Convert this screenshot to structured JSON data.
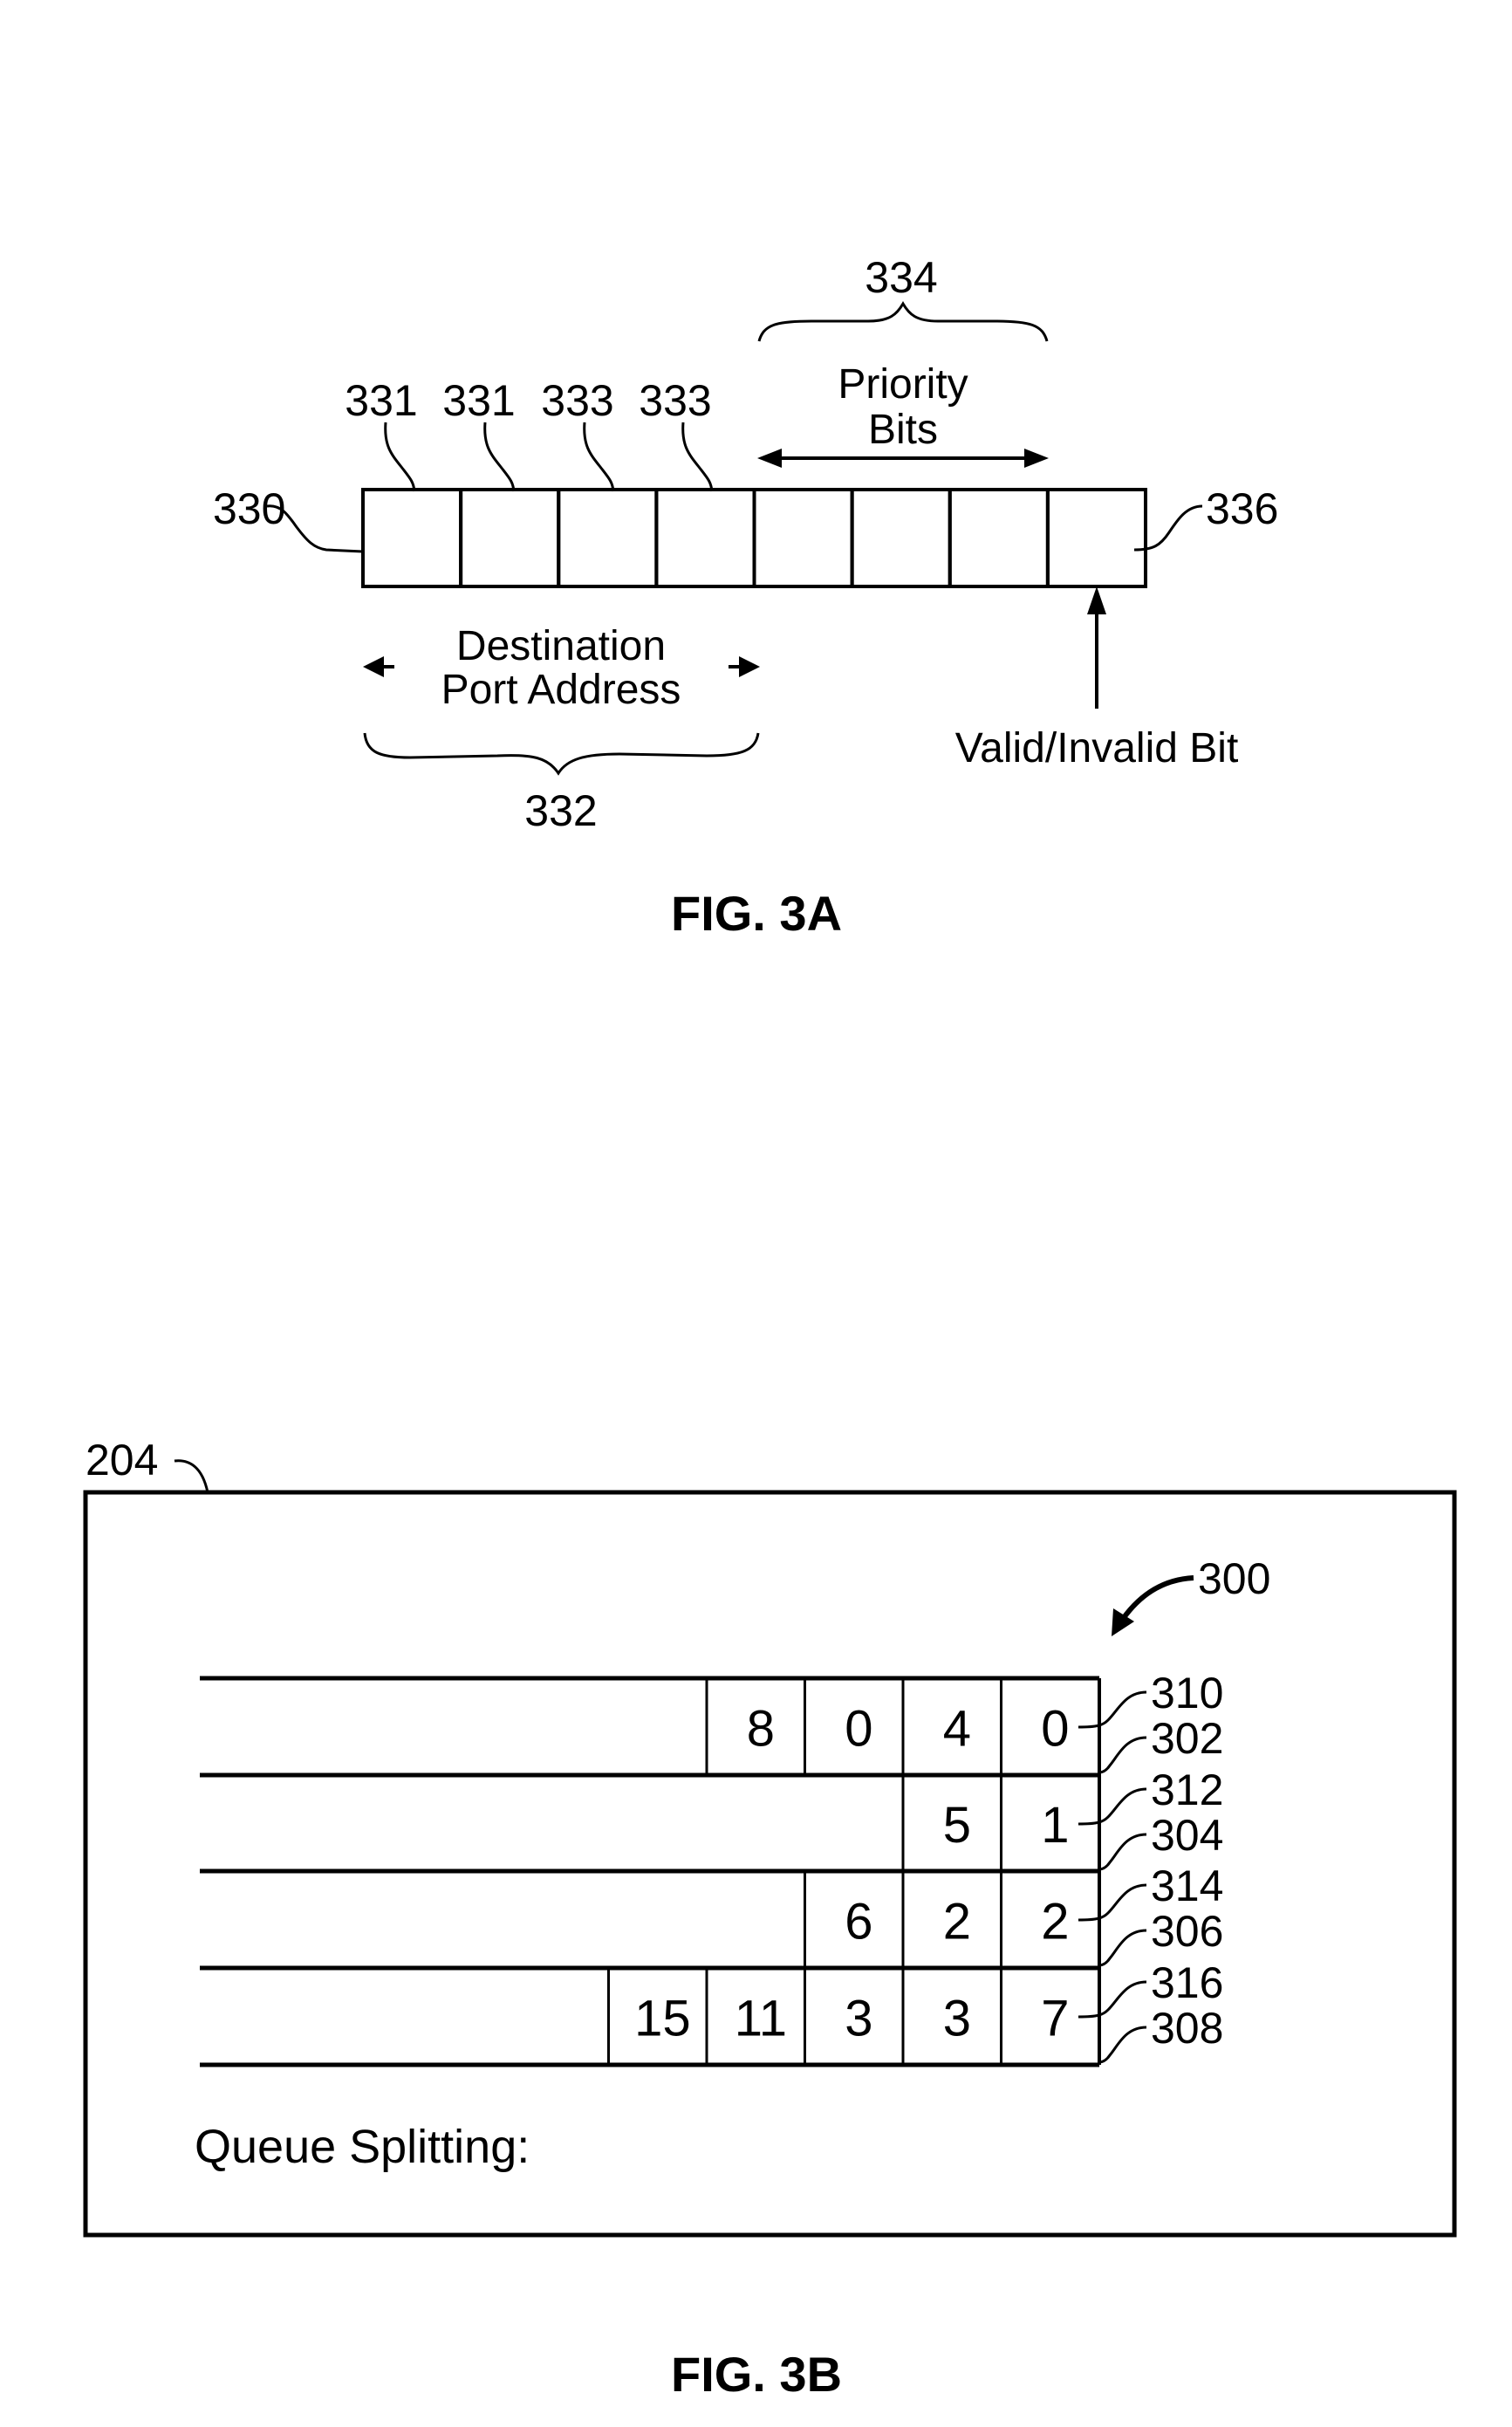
{
  "fig3a": {
    "caption": "FIG. 3A",
    "register_ref": "330",
    "cell_count": 8,
    "cell_refs": [
      "331",
      "331",
      "333",
      "333"
    ],
    "priority_group_ref": "334",
    "priority_label_line1": "Priority",
    "priority_label_line2": "Bits",
    "valid_cell_ref": "336",
    "destination_label_line1": "Destination",
    "destination_label_line2": "Port Address",
    "destination_group_ref": "332",
    "valid_label": "Valid/Invalid Bit"
  },
  "fig3b": {
    "caption": "FIG. 3B",
    "container_ref": "204",
    "structure_ref": "300",
    "footer_label": "Queue Splitting:",
    "queues": [
      {
        "head_ref": "310",
        "queue_ref": "302",
        "values": [
          "8",
          "0",
          "4",
          "0"
        ]
      },
      {
        "head_ref": "312",
        "queue_ref": "304",
        "values": [
          "5",
          "1"
        ]
      },
      {
        "head_ref": "314",
        "queue_ref": "306",
        "values": [
          "6",
          "2",
          "2"
        ]
      },
      {
        "head_ref": "316",
        "queue_ref": "308",
        "values": [
          "15",
          "11",
          "3",
          "3",
          "7"
        ]
      }
    ]
  }
}
